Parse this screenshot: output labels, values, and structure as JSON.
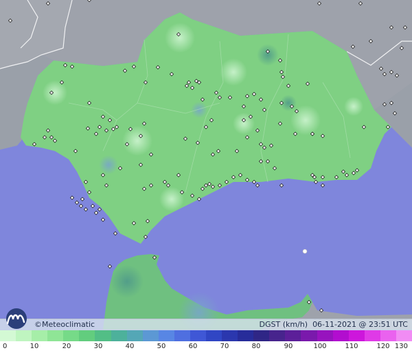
{
  "credit": "©Meteoclimatic",
  "variable": "DGST (km/h)",
  "datetime": "06-11-2021 @ 23:51 UTC",
  "scale_ticks": [
    "0",
    "10",
    "20",
    "30",
    "40",
    "50",
    "60",
    "70",
    "80",
    "90",
    "100",
    "110",
    "120",
    "130"
  ],
  "scale_colors": [
    "#d3f9d4",
    "#bff5c0",
    "#a6eea8",
    "#8fe596",
    "#76da88",
    "#62cd7e",
    "#52be86",
    "#4db19b",
    "#54a7b6",
    "#5c98d4",
    "#5886e4",
    "#4f6fe0",
    "#3f57d6",
    "#3046c4",
    "#2b37ae",
    "#272c9a",
    "#2f2686",
    "#47248d",
    "#5c1f99",
    "#7a19ac",
    "#9713be",
    "#b20dcf",
    "#cd16dc",
    "#df3ae7",
    "#ea62ef",
    "#f18cf4"
  ],
  "colors": {
    "sea": "#7f86dc",
    "land": "#7fd083",
    "foreign_land": "#9ea2ab"
  }
}
